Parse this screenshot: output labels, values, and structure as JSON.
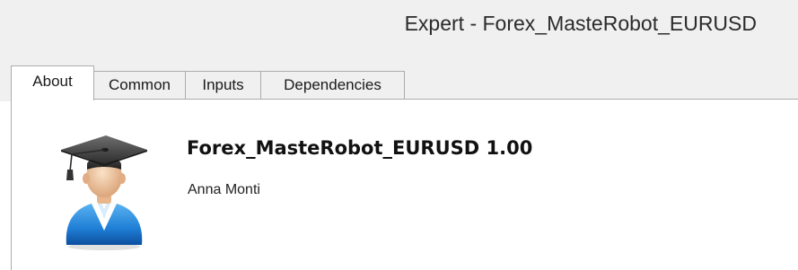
{
  "window": {
    "title": "Expert - Forex_MasteRobot_EURUSD"
  },
  "tabs": [
    {
      "label": "About",
      "active": true
    },
    {
      "label": "Common",
      "active": false
    },
    {
      "label": "Inputs",
      "active": false
    },
    {
      "label": "Dependencies",
      "active": false
    }
  ],
  "about": {
    "icon": "graduate-user-icon",
    "product_name": "Forex_MasteRobot_EURUSD 1.00",
    "author": "Anna Monti"
  },
  "colors": {
    "title_bar": "#f0f0f0",
    "tab_border": "#acacac",
    "icon_blue": "#1f7fd6"
  }
}
